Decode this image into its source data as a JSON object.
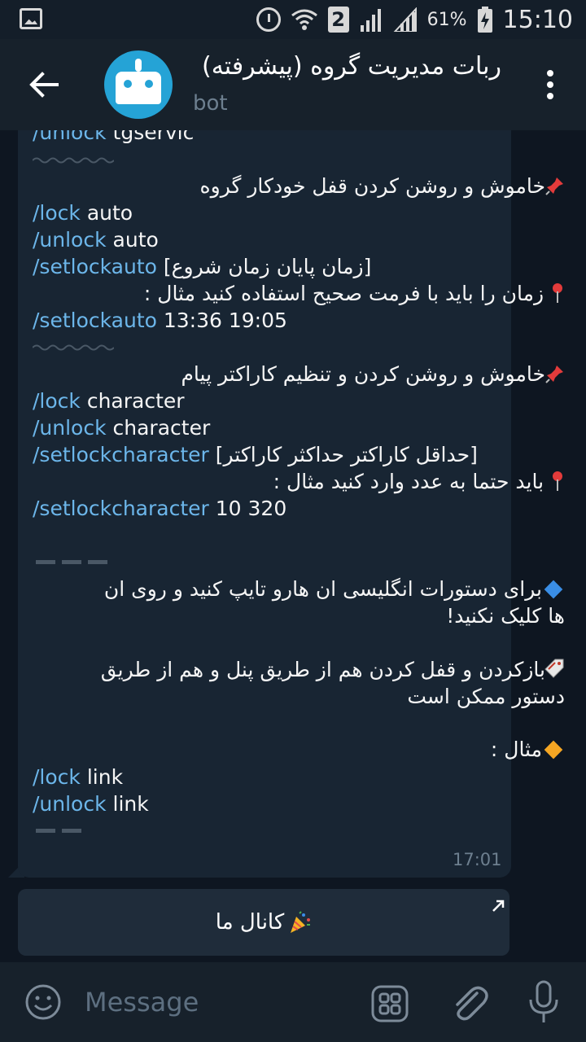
{
  "status_bar": {
    "sim_slot": "2",
    "battery_percent": "61%",
    "time": "15:10",
    "icons": [
      "gallery-icon",
      "alarm-icon",
      "wifi-icon",
      "sim2-icon",
      "signal-icon",
      "signal-icon",
      "battery-charging-icon"
    ]
  },
  "header": {
    "title": "ربات مدیریت گروه (پیشرفته)",
    "subtitle": "bot",
    "back_icon": "back-arrow-icon",
    "menu_icon": "kebab-menu-icon"
  },
  "message": {
    "lines": [
      {
        "cmd": "/unlock",
        "text": " tgservic"
      },
      {
        "rtl": "خاموش و روشن کردن قفل خودکار گروه",
        "icon": "pushpin-icon"
      },
      {
        "cmd": "/lock",
        "text": " auto"
      },
      {
        "cmd": "/unlock",
        "text": " auto"
      },
      {
        "cmd": "/setlockauto",
        "text": " [زمان پایان زمان شروع]"
      },
      {
        "rtl": "زمان را باید با فرمت صحیح استفاده کنید مثال :",
        "icon": "round-pushpin-icon"
      },
      {
        "cmd": "/setlockauto",
        "text": " 13:36 19:05"
      },
      {
        "rtl": "خاموش و روشن کردن و تنظیم کاراکتر پیام",
        "icon": "pushpin-icon"
      },
      {
        "cmd": "/lock",
        "text": " character"
      },
      {
        "cmd": "/unlock",
        "text": " character"
      },
      {
        "cmd": "/setlockcharacter",
        "text": " [حداقل کاراکتر حداکثر کاراکتر]"
      },
      {
        "rtl": "باید حتما به عدد وارد کنید مثال :",
        "icon": "round-pushpin-icon"
      },
      {
        "cmd": "/setlockcharacter",
        "text": " 10 320"
      },
      {
        "rtl": "برای دستورات انگلیسی ان هارو تایپ کنید و روی ان",
        "icon": "blue-diamond-icon"
      },
      {
        "rtl": "ها کلیک نکنید!"
      },
      {
        "rtl": "بازکردن و قفل کردن هم از طریق پنل و هم از طریق",
        "icon": "tag-icon"
      },
      {
        "rtl": "دستور ممکن است"
      },
      {
        "rtl": "مثال :",
        "icon": "orange-diamond-icon"
      },
      {
        "cmd": "/lock",
        "text": " link"
      },
      {
        "cmd": "/unlock",
        "text": " link"
      }
    ],
    "time": "17:01"
  },
  "inline_button": {
    "label": "کانال ما",
    "icon": "party-popper-icon",
    "corner_icon": "external-link-arrow-icon"
  },
  "composer": {
    "placeholder": "Message",
    "icons": [
      "emoji-icon",
      "bot-keyboard-icon",
      "attach-icon",
      "mic-icon"
    ]
  }
}
